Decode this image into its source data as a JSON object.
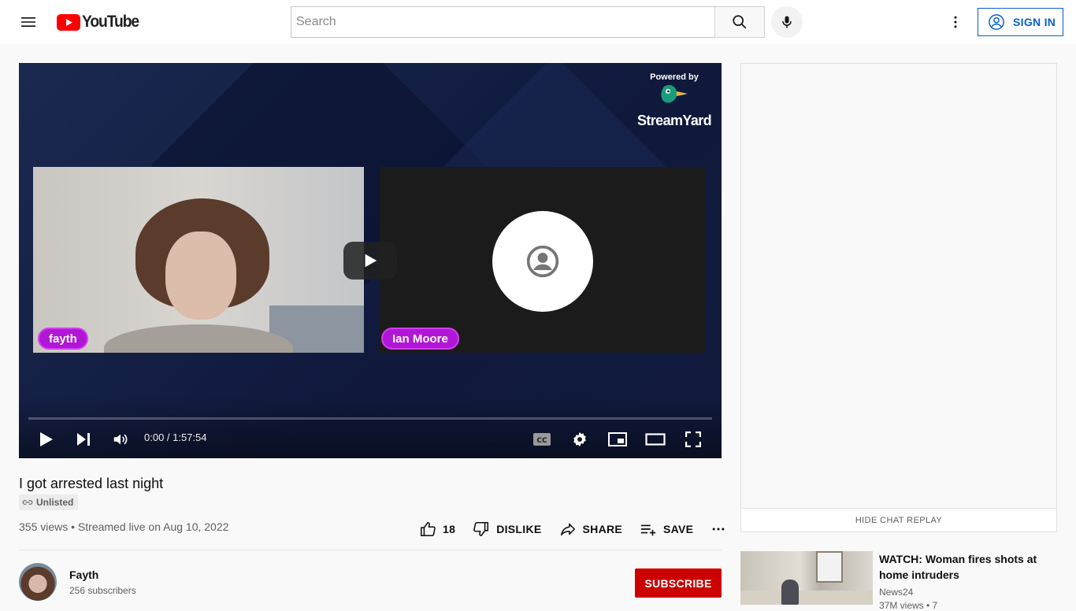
{
  "header": {
    "logo_text": "YouTube",
    "search_placeholder": "Search",
    "signin_label": "SIGN IN"
  },
  "player": {
    "brand_powered": "Powered by",
    "brand_name": "StreamYard",
    "participants": [
      "fayth",
      "Ian Moore"
    ],
    "time": "0:00 / 1:57:54",
    "progress": 0
  },
  "video": {
    "title": "I got arrested last night",
    "badge": "Unlisted",
    "meta": "355 views • Streamed live on Aug 10, 2022",
    "like_count": "18",
    "dislike_label": "DISLIKE",
    "share_label": "SHARE",
    "save_label": "SAVE"
  },
  "channel": {
    "name": "Fayth",
    "subscribers": "256 subscribers",
    "subscribe_label": "SUBSCRIBE"
  },
  "chat": {
    "hide_label": "HIDE CHAT REPLAY"
  },
  "recommended": [
    {
      "title": "WATCH: Woman fires shots at home intruders",
      "channel": "News24",
      "views": "37M views • 7"
    }
  ],
  "colors": {
    "accent_blue": "#065fd4",
    "subscribe_red": "#cc0000",
    "logo_red": "#ff0000",
    "tag_purple": "#b116d6"
  }
}
